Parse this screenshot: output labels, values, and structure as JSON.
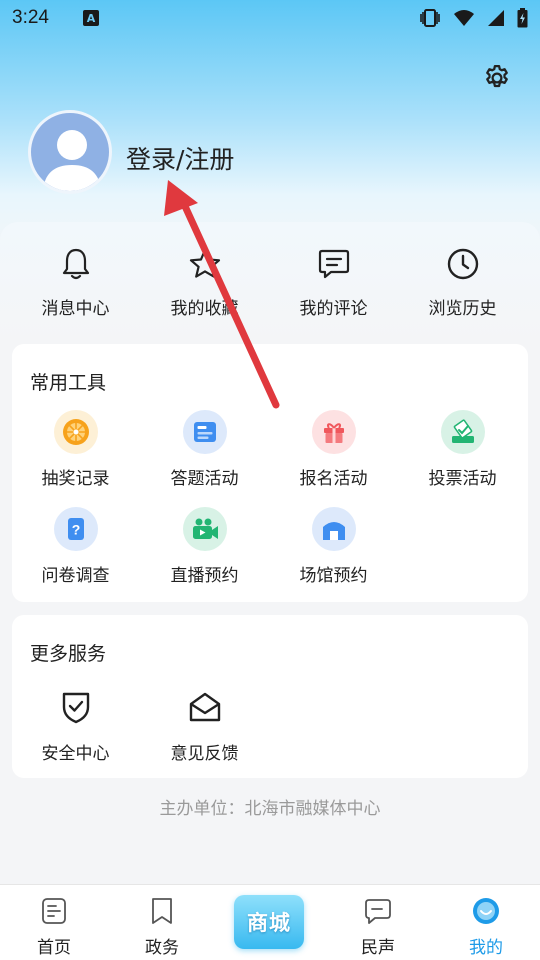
{
  "status_bar": {
    "time": "3:24",
    "notif_letter": "A"
  },
  "profile": {
    "login_label": "登录/注册"
  },
  "quick_actions": [
    {
      "label": "消息中心",
      "icon": "bell-icon"
    },
    {
      "label": "我的收藏",
      "icon": "star-icon"
    },
    {
      "label": "我的评论",
      "icon": "comment-icon"
    },
    {
      "label": "浏览历史",
      "icon": "clock-icon"
    }
  ],
  "tools": {
    "title": "常用工具",
    "items": [
      {
        "label": "抽奖记录",
        "icon": "lottery-wheel-icon",
        "color": "#f7a21b"
      },
      {
        "label": "答题活动",
        "icon": "quiz-card-icon",
        "color": "#3f8ef0"
      },
      {
        "label": "报名活动",
        "icon": "gift-icon",
        "color": "#f0575c"
      },
      {
        "label": "投票活动",
        "icon": "vote-box-icon",
        "color": "#22b573"
      },
      {
        "label": "问卷调查",
        "icon": "questionnaire-icon",
        "color": "#3f8ef0"
      },
      {
        "label": "直播预约",
        "icon": "video-camera-icon",
        "color": "#22b573"
      },
      {
        "label": "场馆预约",
        "icon": "venue-icon",
        "color": "#3f8ef0"
      }
    ]
  },
  "services": {
    "title": "更多服务",
    "items": [
      {
        "label": "安全中心",
        "icon": "shield-check-icon"
      },
      {
        "label": "意见反馈",
        "icon": "envelope-open-icon"
      }
    ]
  },
  "footer_note": "主办单位：北海市融媒体中心",
  "tabbar": {
    "items": [
      {
        "label": "首页",
        "icon": "home-doc-icon"
      },
      {
        "label": "政务",
        "icon": "bookmark-icon"
      },
      {
        "label": "民声",
        "icon": "chat-bubble-icon"
      },
      {
        "label": "我的",
        "icon": "profile-smile-icon"
      }
    ],
    "mall_label": "商城",
    "active": "我的",
    "accent": "#1e9be8"
  },
  "annotation": {
    "arrow_color": "#e0393e"
  }
}
